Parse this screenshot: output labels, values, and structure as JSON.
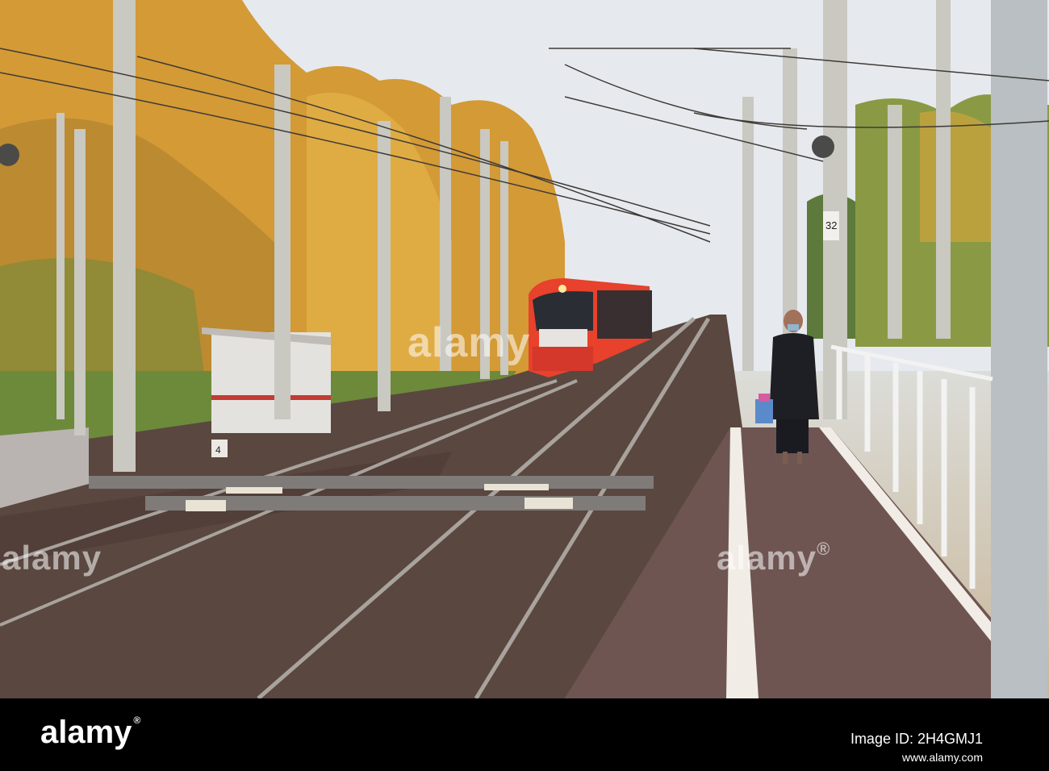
{
  "watermark": {
    "center": "alamy",
    "left": "alamy",
    "right": "alamy",
    "reg": "®"
  },
  "footer": {
    "logo": "alamy",
    "logo_reg": "®",
    "image_id": "Image ID: 2H4GMJ1",
    "site": "www.alamy.com"
  },
  "scene": {
    "train_color": "#e8412c",
    "sign_distance": "4",
    "pole_number": "32"
  },
  "colors": {
    "sky": "#e8ecef",
    "foliage": "#d9a23a",
    "platform": "#6e5552",
    "footer": "#000000"
  }
}
